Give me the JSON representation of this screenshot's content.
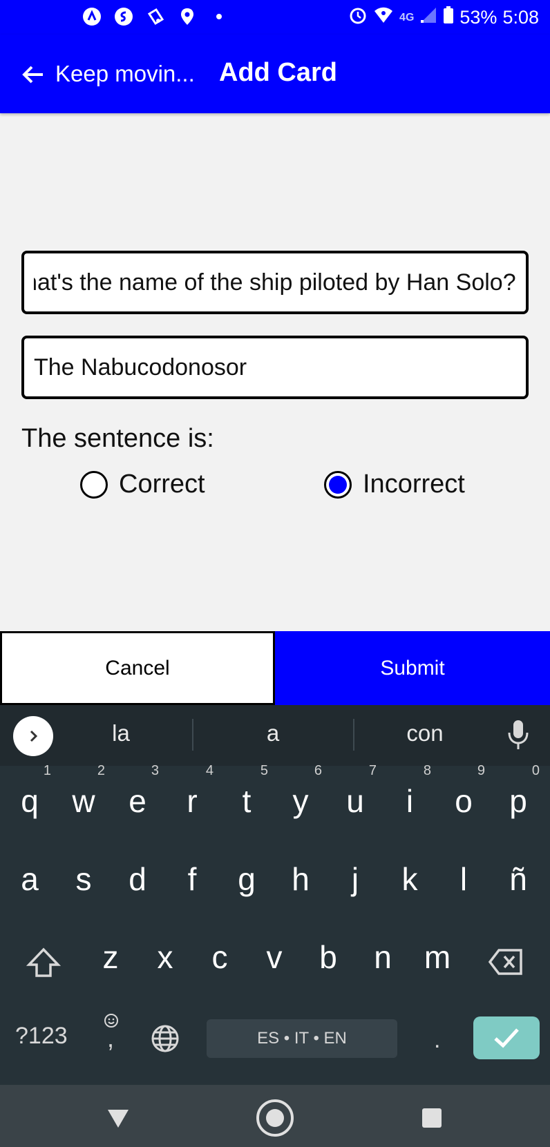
{
  "status_bar": {
    "battery": "53%",
    "time": "5:08",
    "network": "4G",
    "left_icons": [
      "app-a-icon",
      "shazam-icon",
      "game-icon",
      "location-icon",
      "dot-icon"
    ],
    "right_icons": [
      "alarm-icon",
      "wifi-icon",
      "signal-icon",
      "battery-icon"
    ]
  },
  "app_bar": {
    "back_label": "Keep movin...",
    "title": "Add Card"
  },
  "form": {
    "question_value": "What's the name of the ship piloted by Han Solo?",
    "answer_value": "The Nabucodonosor",
    "sentence_label": "The sentence is:",
    "options": [
      {
        "label": "Correct",
        "selected": false
      },
      {
        "label": "Incorrect",
        "selected": true
      }
    ]
  },
  "buttons": {
    "cancel": "Cancel",
    "submit": "Submit"
  },
  "keyboard": {
    "suggestions": [
      "la",
      "a",
      "con"
    ],
    "row1": [
      {
        "k": "q",
        "n": "1"
      },
      {
        "k": "w",
        "n": "2"
      },
      {
        "k": "e",
        "n": "3"
      },
      {
        "k": "r",
        "n": "4"
      },
      {
        "k": "t",
        "n": "5"
      },
      {
        "k": "y",
        "n": "6"
      },
      {
        "k": "u",
        "n": "7"
      },
      {
        "k": "i",
        "n": "8"
      },
      {
        "k": "o",
        "n": "9"
      },
      {
        "k": "p",
        "n": "0"
      }
    ],
    "row2": [
      "a",
      "s",
      "d",
      "f",
      "g",
      "h",
      "j",
      "k",
      "l",
      "ñ"
    ],
    "row3": [
      "z",
      "x",
      "c",
      "v",
      "b",
      "n",
      "m"
    ],
    "symbols_key": "?123",
    "comma_key": ",",
    "period_key": ".",
    "space_label": "ES • IT • EN"
  },
  "colors": {
    "primary": "#0000ff",
    "keyboard_bg": "#263238",
    "enter_key": "#7fcbc4"
  }
}
